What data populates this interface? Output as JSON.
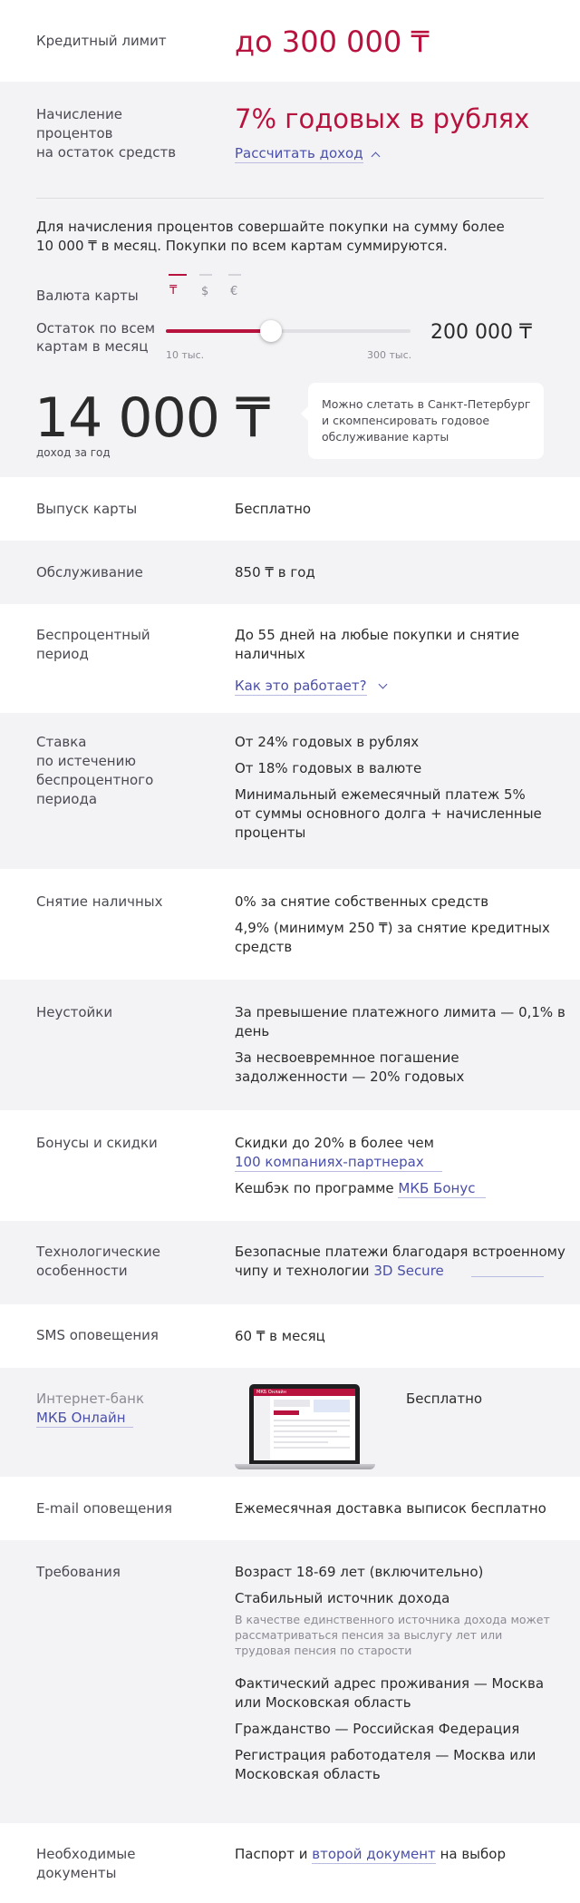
{
  "credit_limit": {
    "label": "Кредитный лимит",
    "value": "до 300 000 ₸"
  },
  "interest": {
    "label_l1": "Начисление",
    "label_l2": "процентов",
    "label_l3": "на остаток средств",
    "value": "7% годовых в рублях",
    "calc_link": "Рассчитать доход"
  },
  "calc": {
    "note_l1": "Для начисления процентов совершайте покупки на сумму более",
    "note_l2": "10 000 ₸  в месяц. Покупки по всем картам суммируются.",
    "currency_label": "Валюта карты",
    "currencies": [
      "₸",
      "$",
      "€"
    ],
    "balance_label_l1": "Остаток по всем",
    "balance_label_l2": "картам в месяц",
    "slider_min": "10 тыс.",
    "slider_max": "300 тыс.",
    "slider_fraction": 0.43,
    "balance_value": "200 000 ₸",
    "income_value": "14 000 ₸",
    "income_label": "доход за год",
    "tip_l1": "Можно слетать в Санкт-Петербург",
    "tip_l2": "и скомпенсировать годовое",
    "tip_l3": "обслуживание карты"
  },
  "issue": {
    "label": "Выпуск карты",
    "value": "Бесплатно"
  },
  "service": {
    "label": "Обслуживание",
    "value": "850 ₸ в год"
  },
  "grace": {
    "label_l1": "Беспроцентный",
    "label_l2": "период",
    "value_l1": "До 55 дней на любые покупки и снятие",
    "value_l2": "наличных",
    "link": "Как это работает?"
  },
  "rate": {
    "label_l1": "Ставка",
    "label_l2": "по истечению",
    "label_l3": "беспроцентного",
    "label_l4": "периода",
    "v1": "От 24% годовых в рублях",
    "v2": "От 18% годовых в валюте",
    "v3_l1": "Минимальный ежемесячный платеж 5%",
    "v3_l2": "от суммы основного долга + начисленные",
    "v3_l3": "проценты"
  },
  "cash": {
    "label": "Снятие наличных",
    "v1": "0% за снятие собственных средств",
    "v2_l1": "4,9% (минимум 250 ₸) за снятие кредитных",
    "v2_l2": "средств"
  },
  "penalty": {
    "label": "Неустойки",
    "v1_l1": "За превышение платежного лимита — 0,1% в",
    "v1_l2": "день",
    "v2_l1": "За несвоевремнное погашение",
    "v2_l2": "задолженности — 20% годовых"
  },
  "bonus": {
    "label": "Бонусы и скидки",
    "v1": "Скидки до 20% в более чем",
    "v1_link": "100 компаниях-партнерах",
    "v2": "Кешбэк по программе ",
    "v2_link": "МКБ Бонус"
  },
  "tech": {
    "label_l1": "Технологические",
    "label_l2": "особенности",
    "v_l1": "Безопасные платежи благодаря встроенному",
    "v_l2": "чипу и технологии ",
    "v_link": "3D Secure"
  },
  "sms": {
    "label": "SMS оповещения",
    "value": "60 ₸ в месяц"
  },
  "ibank": {
    "label": "Интернет-банк",
    "link": "МКБ Онлайн",
    "value": "Бесплатно",
    "logo": "МКБ Онлайн"
  },
  "email": {
    "label": "E-mail оповещения",
    "value": "Ежемесячная доставка выписок бесплатно"
  },
  "req": {
    "label": "Требования",
    "v1": "Возраст 18-69 лет (включительно)",
    "v2": "Стабильный источник дохода",
    "note_l1": "В качестве единственного источника дохода может",
    "note_l2": "рассматриваться пенсия за выслугу лет или",
    "note_l3": "трудовая пенсия по старости",
    "v3_l1": "Фактический адрес проживания — Москва",
    "v3_l2": "или Московская область",
    "v4": "Гражданство — Российская Федерация",
    "v5_l1": "Регистрация работодателя — Москва или",
    "v5_l2": "Московская область"
  },
  "docs": {
    "label_l1": "Необходимые",
    "label_l2": "документы",
    "v_pre": "Паспорт и ",
    "v_link": "второй документ",
    "v_post": " на выбор"
  },
  "colors": {
    "accent": "#b8123e",
    "link": "#4a4fa8",
    "gray_bg": "#f3f3f5"
  }
}
